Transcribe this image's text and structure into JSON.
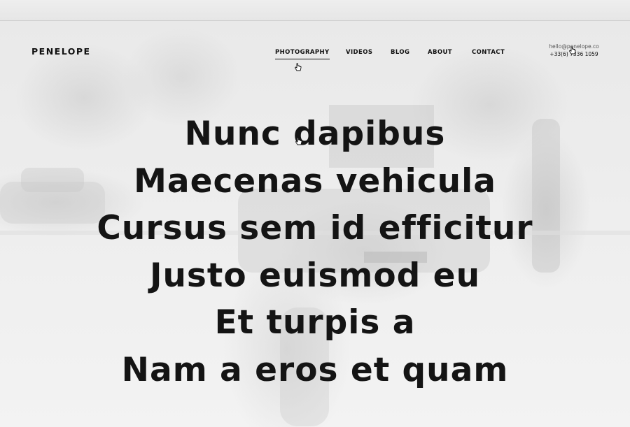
{
  "site": {
    "logo": "PENELOPE"
  },
  "nav": {
    "items": [
      {
        "label": "PHOTOGRAPHY",
        "active": true
      },
      {
        "label": "VIDEOS",
        "active": false
      },
      {
        "label": "BLOG",
        "active": false
      },
      {
        "label": "ABOUT",
        "active": false
      },
      {
        "label": "CONTACT",
        "active": false
      }
    ]
  },
  "contact": {
    "email": "hello@penelope.co",
    "phone": "+33(6) 7336 1059"
  },
  "hero": {
    "lines": [
      "Nunc dapibus",
      "Maecenas vehicula",
      "Cursus sem id efficitur",
      "Justo euismod eu",
      "Et turpis a",
      "Nam a eros et quam"
    ]
  },
  "icons": {
    "cursor": "hand-pointer-icon"
  }
}
